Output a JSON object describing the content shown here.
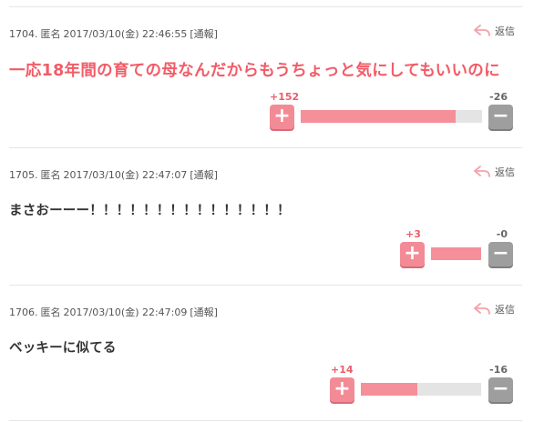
{
  "reply_label": "返信",
  "colors": {
    "accent": "#f25c67",
    "plus_button": "#f38b96",
    "minus_button": "#9e9e9e",
    "bar_fill": "#f58f99",
    "bar_track": "#e4e4e4"
  },
  "comments": [
    {
      "number": "1704.",
      "name": "匿名",
      "datetime": "2017/03/10(金) 22:46:55",
      "report": "[通報]",
      "text": "一応18年間の育ての母なんだからもうちょっと気にしてもいいのに",
      "plus": "+152",
      "minus": "-26",
      "plus_ratio": 0.854
    },
    {
      "number": "1705.",
      "name": "匿名",
      "datetime": "2017/03/10(金) 22:47:07",
      "report": "[通報]",
      "text": "まさおーーー！！！！！！！！！！！！！！！",
      "plus": "+3",
      "minus": "-0",
      "plus_ratio": 1.0
    },
    {
      "number": "1706.",
      "name": "匿名",
      "datetime": "2017/03/10(金) 22:47:09",
      "report": "[通報]",
      "text": "ベッキーに似てる",
      "plus": "+14",
      "minus": "-16",
      "plus_ratio": 0.467
    }
  ]
}
